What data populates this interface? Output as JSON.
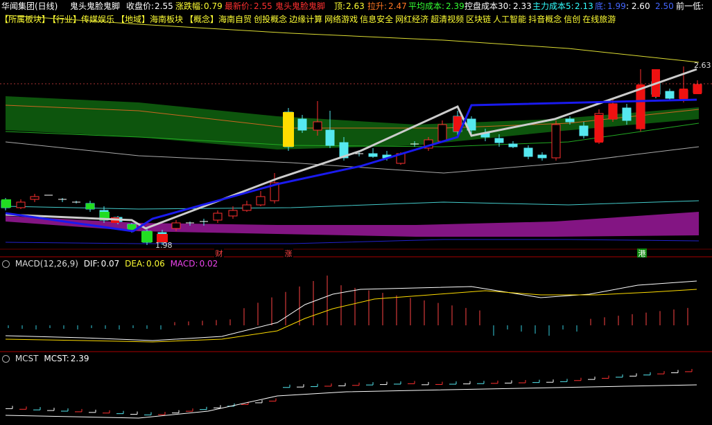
{
  "header": {
    "stock": "华闻集团(日线)",
    "strategy": "鬼头鬼脸鬼脚",
    "close_label": "收盘价:",
    "close_value": "2.55",
    "change_label": "涨跌幅:",
    "change_value": "0.79",
    "last_label": "最新价:",
    "last_value": "2.55",
    "strategy2": "鬼头鬼脸鬼脚",
    "top_label": "顶:",
    "top_value": "2.63",
    "pull_label": "拉升:",
    "pull_value": "2.47",
    "avgcost_label": "平均成本:",
    "avgcost_value": "2.39",
    "ctrl_label": "控盘成本30:",
    "ctrl_value": "2.33",
    "main_label": "主力成本5:",
    "main_value": "2.13",
    "low_label": "底:",
    "low_value": "1.99",
    "mid_value": ": 2.60",
    "mid2_value": "2.50",
    "prev_label": "前一低:"
  },
  "sectors": [
    "【所属板块】",
    "【行业】传媒娱乐",
    "【地域】海南板块",
    "【概念】海南自贸",
    "创投概念",
    "边缘计算",
    "网络游戏",
    "信息安全",
    "网红经济",
    "超清视频",
    "区块链",
    "人工智能",
    "抖音概念",
    "信创",
    "在线旅游"
  ],
  "price_labels": {
    "high": "2.63",
    "low": "1.98"
  },
  "markers": [
    {
      "label": "财",
      "bg": "#000",
      "color": "#ff4444"
    },
    {
      "label": "涨",
      "bg": "#000",
      "color": "#ff4444"
    },
    {
      "label": "港",
      "bg": "#118811",
      "color": "#ffffff"
    }
  ],
  "macd": {
    "title": "MACD(12,26,9)",
    "dif_label": "DIF:",
    "dif_value": "0.07",
    "dea_label": "DEA:",
    "dea_value": "0.06",
    "macd_label": "MACD:",
    "macd_value": "0.02"
  },
  "mcst": {
    "title": "MCST",
    "label": "MCST:",
    "value": "2.39"
  },
  "colors": {
    "up": "#ff3030",
    "down": "#55e8f0",
    "border": "#8b0000",
    "white_line": "#dddddd",
    "yellow": "#eedd00",
    "magenta": "#ee44ee",
    "blue": "#1a1aee"
  }
}
